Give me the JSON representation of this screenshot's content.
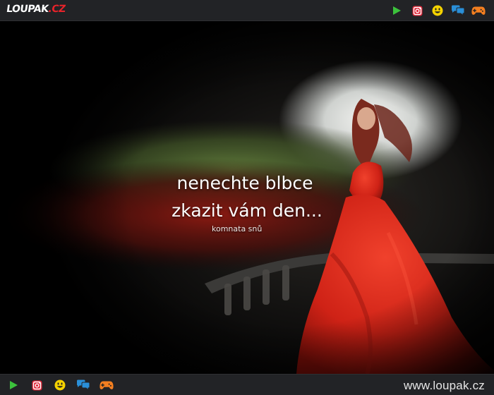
{
  "header": {
    "logo_main": "LOUPAK",
    "logo_ext": ".CZ",
    "icons": [
      "play-icon",
      "instagram-icon",
      "smiley-icon",
      "chat-icon",
      "gamepad-icon"
    ]
  },
  "image": {
    "quote_line1": "nenechte blbce",
    "quote_line2": "zkazit vám den...",
    "credit": "komnata snů"
  },
  "footer": {
    "icons": [
      "play-icon",
      "instagram-icon",
      "smiley-icon",
      "chat-icon",
      "gamepad-icon"
    ],
    "site_url": "www.loupak.cz"
  },
  "colors": {
    "bar_bg": "#222326",
    "play": "#3cc23c",
    "instagram": "#e0283a",
    "smiley": "#f5d300",
    "chat": "#2a8fd8",
    "gamepad": "#f47f20",
    "dress": "#d8261a"
  }
}
